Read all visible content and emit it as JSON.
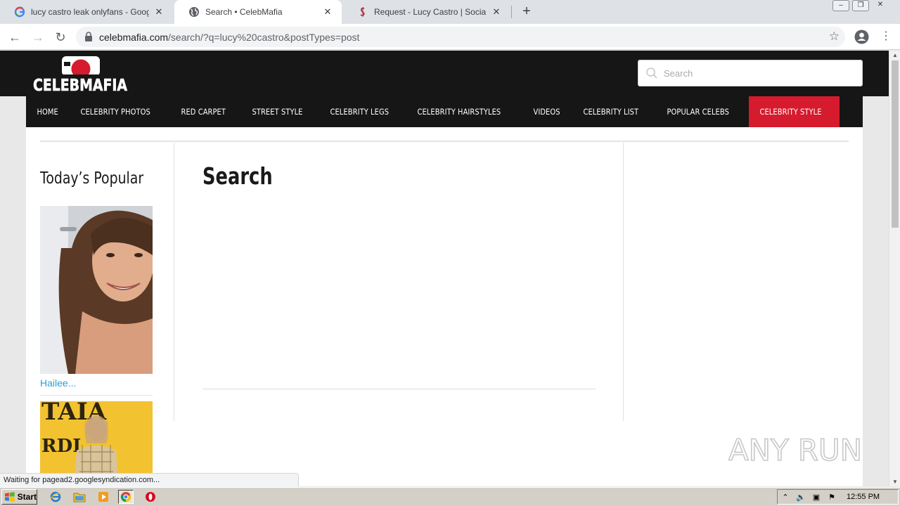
{
  "browser": {
    "tabs": [
      {
        "title": "lucy castro leak onlyfans - Google Se",
        "favicon": "google-icon",
        "active": false
      },
      {
        "title": "Search • CelebMafia",
        "favicon": "globe-icon",
        "active": true
      },
      {
        "title": "Request - Lucy Castro | Social Media",
        "favicon": "dollar-icon",
        "active": false
      }
    ],
    "close_glyph": "✕",
    "newtab_glyph": "+",
    "url_host": "celebmafia.com",
    "url_rest": "/search/?q=lucy%20castro&postTypes=post",
    "status_text": "Waiting for pagead2.googlesyndication.com..."
  },
  "site": {
    "logo_text": "CELEBMAFIA",
    "search_placeholder": "Search",
    "nav": [
      {
        "label": "HOME"
      },
      {
        "label": "CELEBRITY PHOTOS"
      },
      {
        "label": "RED CARPET"
      },
      {
        "label": "STREET STYLE"
      },
      {
        "label": "CELEBRITY LEGS"
      },
      {
        "label": "CELEBRITY HAIRSTYLES"
      },
      {
        "label": "VIDEOS"
      },
      {
        "label": "CELEBRITY LIST"
      },
      {
        "label": "POPULAR CELEBS"
      },
      {
        "label": "CELEBRITY STYLE",
        "highlight": true
      }
    ],
    "sidebar": {
      "title": "Today’s Popular",
      "items": [
        {
          "caption": "Hailee..."
        }
      ]
    },
    "main": {
      "title": "Search"
    },
    "colors": {
      "header_bg": "#161616",
      "nav_highlight": "#d51b2d",
      "link": "#2a9fd6"
    }
  },
  "watermark": "ANY RUN",
  "taskbar": {
    "start_label": "Start",
    "apps": [
      "ie-icon",
      "explorer-folder-icon",
      "media-player-icon",
      "chrome-icon",
      "opera-icon"
    ],
    "clock": "12:55 PM"
  }
}
